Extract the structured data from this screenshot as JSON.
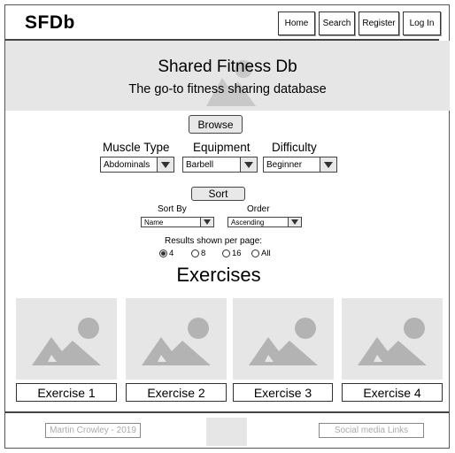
{
  "header": {
    "logo": "SFDb",
    "nav": [
      {
        "label": "Home"
      },
      {
        "label": "Search"
      },
      {
        "label": "Register"
      },
      {
        "label": "Log In"
      }
    ]
  },
  "hero": {
    "title": "Shared Fitness Db",
    "subtitle": "The go-to fitness sharing database"
  },
  "filters": {
    "browse_label": "Browse",
    "muscle_label": "Muscle Type",
    "muscle_value": "Abdominals",
    "equipment_label": "Equipment",
    "equipment_value": "Barbell",
    "difficulty_label": "Difficulty",
    "difficulty_value": "Beginner"
  },
  "sort": {
    "button_label": "Sort",
    "sortby_label": "Sort By",
    "sortby_value": "Name",
    "order_label": "Order",
    "order_value": "Ascending"
  },
  "results": {
    "label": "Results shown per page:",
    "options": [
      "4",
      "8",
      "16",
      "All"
    ],
    "selected": "4"
  },
  "exercises": {
    "title": "Exercises",
    "items": [
      {
        "label": "Exercise 1"
      },
      {
        "label": "Exercise 2"
      },
      {
        "label": "Exercise 3"
      },
      {
        "label": "Exercise 4"
      }
    ]
  },
  "footer": {
    "credit": "Martin Crowley - 2019",
    "social": "Social media Links"
  },
  "colors": {
    "placeholder": "#e6e6e6",
    "placeholder_icon": "#b3b3b3",
    "border": "#333333"
  }
}
